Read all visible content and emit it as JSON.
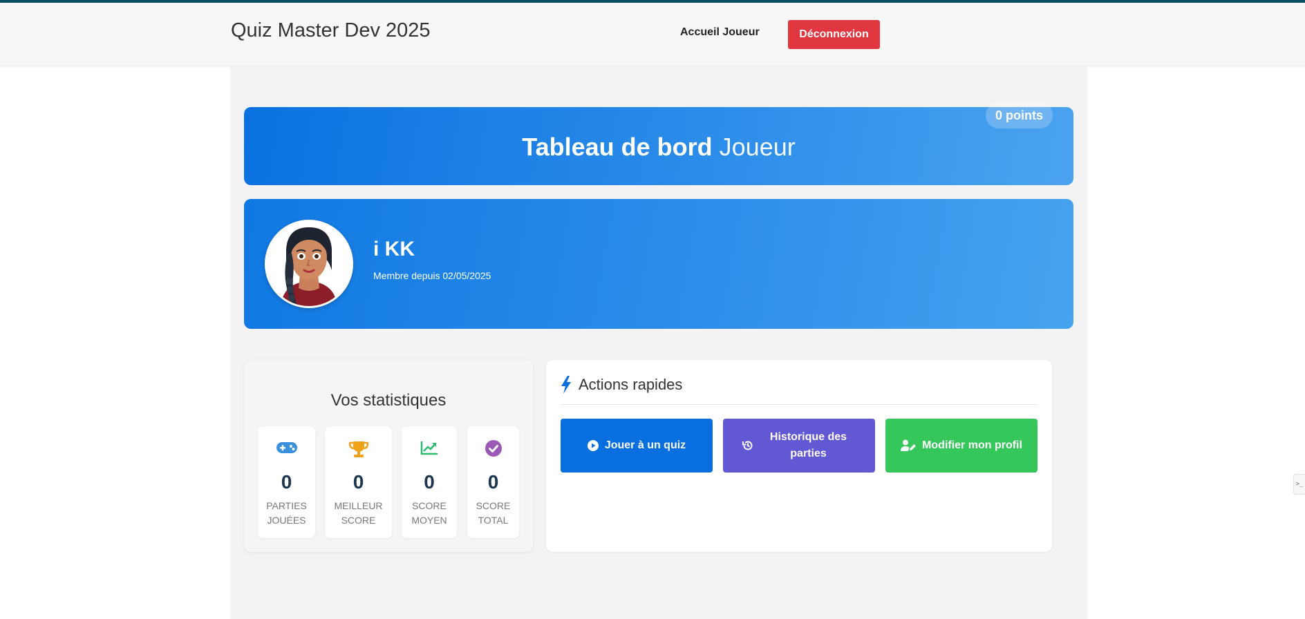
{
  "navbar": {
    "brand": "Quiz Master Dev 2025",
    "home_link": "Accueil Joueur",
    "logout_label": "Déconnexion",
    "logout_color": "#e0363f"
  },
  "hero": {
    "title_bold": "Tableau de bord",
    "title_light": "Joueur",
    "points": "0 points"
  },
  "profile": {
    "name": "i KK",
    "member_since": "Membre depuis 02/05/2025"
  },
  "stats": {
    "title": "Vos statistiques",
    "items": [
      {
        "icon": "gamepad-icon",
        "value": "0",
        "label": "PARTIES JOUÉES",
        "color": "#3a8fdc"
      },
      {
        "icon": "trophy-icon",
        "value": "0",
        "label": "MEILLEUR SCORE",
        "color": "#f0a21b"
      },
      {
        "icon": "chart-line-icon",
        "value": "0",
        "label": "SCORE MOYEN",
        "color": "#2bbd6e"
      },
      {
        "icon": "check-circle-icon",
        "value": "0",
        "label": "SCORE TOTAL",
        "color": "#9b59b6"
      }
    ]
  },
  "actions": {
    "title": "Actions rapides",
    "buttons": [
      {
        "icon": "play-circle-icon",
        "label": "Jouer à un quiz",
        "color": "#0a6fde"
      },
      {
        "icon": "history-icon",
        "label": "Historique des parties",
        "color": "#6358d4"
      },
      {
        "icon": "user-edit-icon",
        "label": "Modifier mon profil",
        "color": "#35c75a"
      }
    ]
  },
  "side_tab": {
    "glyph": ">_"
  }
}
